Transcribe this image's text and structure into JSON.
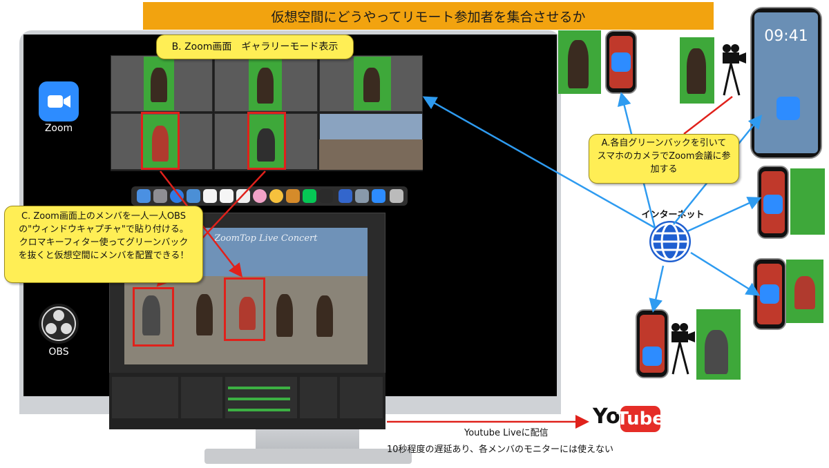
{
  "title": "仮想空間にどうやってリモート参加者を集合させるか",
  "desktop": {
    "zoom_label": "Zoom",
    "obs_label": "OBS"
  },
  "callouts": {
    "b": "B. Zoom画面　ギャラリーモード表示",
    "c_line1": "C. Zoom画面上のメンバを一人一人OBS",
    "c_line2": "の\"ウィンドウキャプチャ\"で貼り付ける。",
    "c_line3": "クロマキーフィター使ってグリーンバック",
    "c_line4": "を抜くと仮想空間にメンバを配置できる！",
    "a_line1": "A.各自グリーンバックを引いて",
    "a_line2": "スマホのカメラでZoom会議に参",
    "a_line3": "加する"
  },
  "internet_label": "インターネット",
  "obs_canvas_title": "ZoomTop Live Concert",
  "youtube": {
    "logo_you": "You",
    "logo_tube": "Tube",
    "caption1": "Youtube Liveに配信",
    "caption2": "10秒程度の遅延あり、各メンバのモニターには使えない"
  },
  "phone_time": "09:41",
  "colors": {
    "title_bg": "#f2a30f",
    "callout_bg": "#ffee55",
    "arrow_red": "#e0211b",
    "arrow_blue": "#2e9bf0",
    "zoom_blue": "#2d8cff",
    "green_screen": "#3ea83a"
  }
}
